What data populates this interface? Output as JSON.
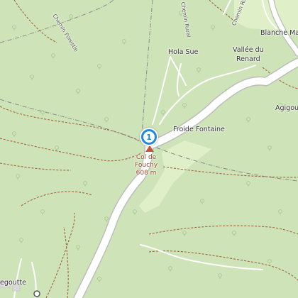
{
  "places": {
    "blanche": "Blanche Ma",
    "hola_sue": "Hola Sue",
    "vallee_line1": "Vallée du",
    "vallee_line2": "Renard",
    "agigou": "Agigou",
    "froide_fontaine": "Froide Fontaine",
    "col_line1": "Col de",
    "col_line2": "Fouchy",
    "col_elevation": "608 m",
    "egoutte": "egoutte"
  },
  "roads": {
    "chemin_forestier": "Chemin Forestie",
    "chemin_rural_1": "Chemin Rural",
    "chemin_rural_2": "Chemin Ru"
  },
  "marker": {
    "label": "1",
    "color": "#1e88e5"
  },
  "colors": {
    "forest": "#cfe3b8",
    "meadow": "#dff0c8",
    "road": "#ffffff",
    "track": "#a0653a"
  }
}
